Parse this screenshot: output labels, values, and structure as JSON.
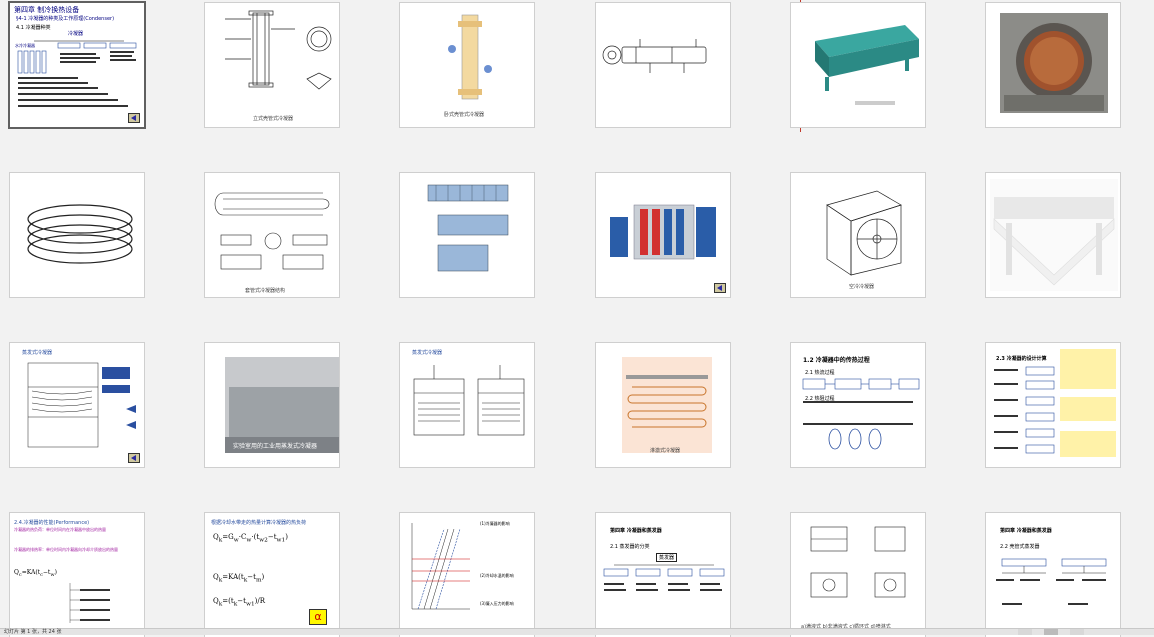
{
  "slides": [
    {
      "id": "1",
      "title": "第四章 制冷换热设备",
      "sub": "§4-1 冷凝器的种类及工作原理(Condenser)",
      "heading": "4.1 冷凝器种类",
      "label": "冷凝器",
      "label2": "水冷冷凝器",
      "selected": true
    },
    {
      "id": "2",
      "caption": "立式壳管式冷凝器"
    },
    {
      "id": "3",
      "caption": "卧式壳管式冷凝器"
    },
    {
      "id": "4",
      "caption": ""
    },
    {
      "id": "5",
      "caption": ""
    },
    {
      "id": "6",
      "caption": ""
    },
    {
      "id": "7",
      "caption": ""
    },
    {
      "id": "8",
      "caption": "套管式冷凝器结构"
    },
    {
      "id": "9",
      "caption": ""
    },
    {
      "id": "10",
      "caption": ""
    },
    {
      "id": "11",
      "caption": "空冷冷凝器"
    },
    {
      "id": "12",
      "caption": ""
    },
    {
      "id": "13",
      "title": "蒸发式冷凝器",
      "caption": ""
    },
    {
      "id": "14",
      "caption": "实验室用的工业用蒸发式冷凝器"
    },
    {
      "id": "15",
      "title": "蒸发式冷凝器",
      "caption": ""
    },
    {
      "id": "16",
      "caption": "淋激式冷凝器"
    },
    {
      "id": "17",
      "title": "1.2 冷凝器中的传热过程",
      "heading": "2.1 热流过程",
      "heading2": "2.2 热阻过程"
    },
    {
      "id": "18",
      "title": "2.3 冷凝器的设计计算"
    },
    {
      "id": "19",
      "title": "2.4.冷凝器的性能(Performance)",
      "line1": "冷凝器的热负荷：单位时间内在冷凝器中放出的热量",
      "line2": "冷凝器的排热率：单位时间内冷凝器向冷却介质放出的热量"
    },
    {
      "id": "20",
      "title": "根据冷却水带走的热量计算冷凝器的热负荷",
      "symbol": "α"
    },
    {
      "id": "21",
      "line1": "(1)冷凝器的影响",
      "line2": "(2)冷却水温的影响",
      "line3": "(3)凝入压力的影响"
    },
    {
      "id": "22",
      "title": "第四章 冷凝器和蒸发器",
      "heading": "2.1 蒸发器的分类",
      "label": "蒸发器"
    },
    {
      "id": "23",
      "caption": "a)满液式 b)非满液式 c)循环式 d)喷淋式"
    },
    {
      "id": "24",
      "title": "第四章 冷凝器和蒸发器",
      "heading": "2.2 壳管式蒸发器"
    }
  ],
  "status": {
    "text": "幻灯片 第 1 张，共 24 张"
  },
  "colors": {
    "accent": "#2a4fa0",
    "selection": "#606060",
    "insertion": "#c0392b"
  }
}
